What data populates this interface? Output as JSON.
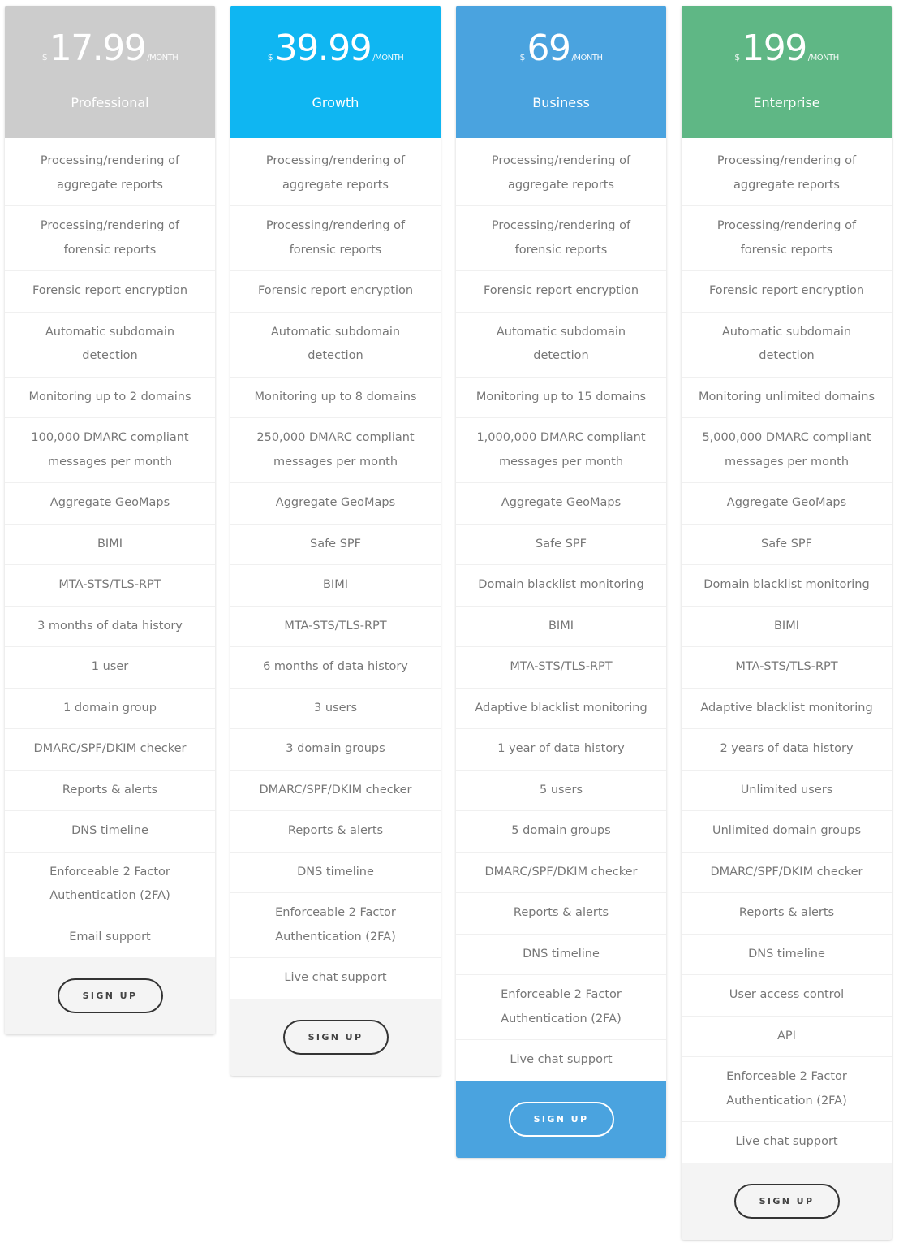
{
  "colors": {
    "professional": "#cccccc",
    "growth": "#0fb6f2",
    "business": "#4aa3df",
    "enterprise": "#5fb785",
    "featured_footer": "#4aa3df"
  },
  "plans": [
    {
      "name": "Professional",
      "currency": "$",
      "amount": "17.99",
      "period": "/MONTH",
      "button": "SIGN UP",
      "features": [
        "Processing/rendering of aggregate reports",
        "Processing/rendering of forensic reports",
        "Forensic report encryption",
        "Automatic subdomain detection",
        "Monitoring up to 2 domains",
        "100,000 DMARC compliant messages per month",
        "Aggregate GeoMaps",
        "BIMI",
        "MTA-STS/TLS-RPT",
        "3 months of data history",
        "1 user",
        "1 domain group",
        "DMARC/SPF/DKIM checker",
        "Reports & alerts",
        "DNS timeline",
        "Enforceable 2 Factor Authentication (2FA)",
        "Email support"
      ]
    },
    {
      "name": "Growth",
      "currency": "$",
      "amount": "39.99",
      "period": "/MONTH",
      "button": "SIGN UP",
      "features": [
        "Processing/rendering of aggregate reports",
        "Processing/rendering of forensic reports",
        "Forensic report encryption",
        "Automatic subdomain detection",
        "Monitoring up to 8 domains",
        "250,000 DMARC compliant messages per month",
        "Aggregate GeoMaps",
        "Safe SPF",
        "BIMI",
        "MTA-STS/TLS-RPT",
        "6 months of data history",
        "3 users",
        "3 domain groups",
        "DMARC/SPF/DKIM checker",
        "Reports & alerts",
        "DNS timeline",
        "Enforceable 2 Factor Authentication (2FA)",
        "Live chat support"
      ]
    },
    {
      "name": "Business",
      "currency": "$",
      "amount": "69",
      "period": "/MONTH",
      "button": "SIGN UP",
      "featured": true,
      "features": [
        "Processing/rendering of aggregate reports",
        "Processing/rendering of forensic reports",
        "Forensic report encryption",
        "Automatic subdomain detection",
        "Monitoring up to 15 domains",
        "1,000,000 DMARC compliant messages per month",
        "Aggregate GeoMaps",
        "Safe SPF",
        "Domain blacklist monitoring",
        "BIMI",
        "MTA-STS/TLS-RPT",
        "Adaptive blacklist monitoring",
        "1 year of data history",
        "5 users",
        "5 domain groups",
        "DMARC/SPF/DKIM checker",
        "Reports & alerts",
        "DNS timeline",
        "Enforceable 2 Factor Authentication (2FA)",
        "Live chat support"
      ]
    },
    {
      "name": "Enterprise",
      "currency": "$",
      "amount": "199",
      "period": "/MONTH",
      "button": "SIGN UP",
      "features": [
        "Processing/rendering of aggregate reports",
        "Processing/rendering of forensic reports",
        "Forensic report encryption",
        "Automatic subdomain detection",
        "Monitoring unlimited domains",
        "5,000,000 DMARC compliant messages per month",
        "Aggregate GeoMaps",
        "Safe SPF",
        "Domain blacklist monitoring",
        "BIMI",
        "MTA-STS/TLS-RPT",
        "Adaptive blacklist monitoring",
        "2 years of data history",
        "Unlimited users",
        "Unlimited domain groups",
        "DMARC/SPF/DKIM checker",
        "Reports & alerts",
        "DNS timeline",
        "User access control",
        "API",
        "Enforceable 2 Factor Authentication (2FA)",
        "Live chat support"
      ]
    }
  ]
}
